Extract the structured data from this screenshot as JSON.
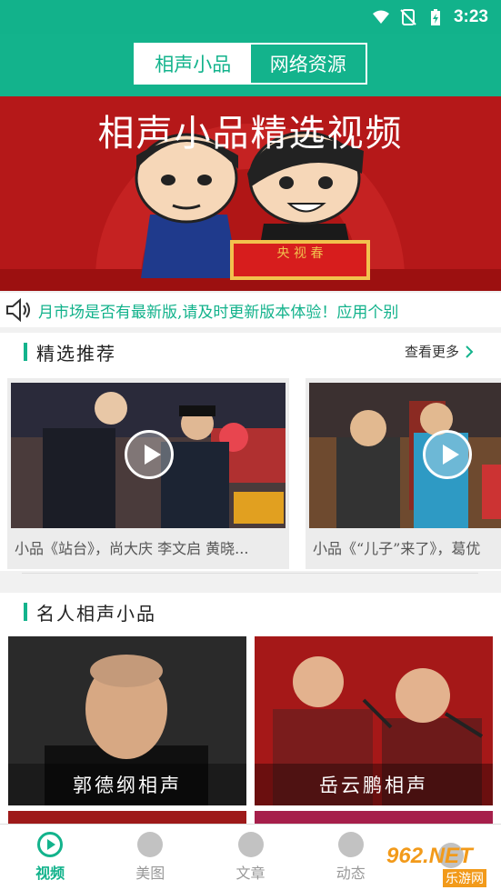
{
  "status": {
    "time": "3:23"
  },
  "header": {
    "tab_active": "相声小品",
    "tab_inactive": "网络资源"
  },
  "banner": {
    "title": "相声小品精选视频",
    "sign": "央 视 春"
  },
  "notice": {
    "text": "月市场是否有最新版,请及时更新版本体验！应用个别"
  },
  "featured": {
    "title": "精选推荐",
    "more": "查看更多",
    "items": [
      {
        "caption": "小品《站台》，尚大庆 李文启 黄晓..."
      },
      {
        "caption": "小品《“儿子”来了》，葛优"
      }
    ]
  },
  "famous": {
    "title": "名人相声小品",
    "items": [
      {
        "label": "郭德纲相声"
      },
      {
        "label": "岳云鹏相声"
      }
    ]
  },
  "tabbar": [
    {
      "label": "视频"
    },
    {
      "label": "美图"
    },
    {
      "label": "文章"
    },
    {
      "label": "动态"
    },
    {
      "label": ""
    }
  ],
  "watermark": {
    "brand": "962.NET",
    "sub": "乐游网"
  },
  "colors": {
    "brand": "#13b38c",
    "banner_red": "#b51819"
  }
}
